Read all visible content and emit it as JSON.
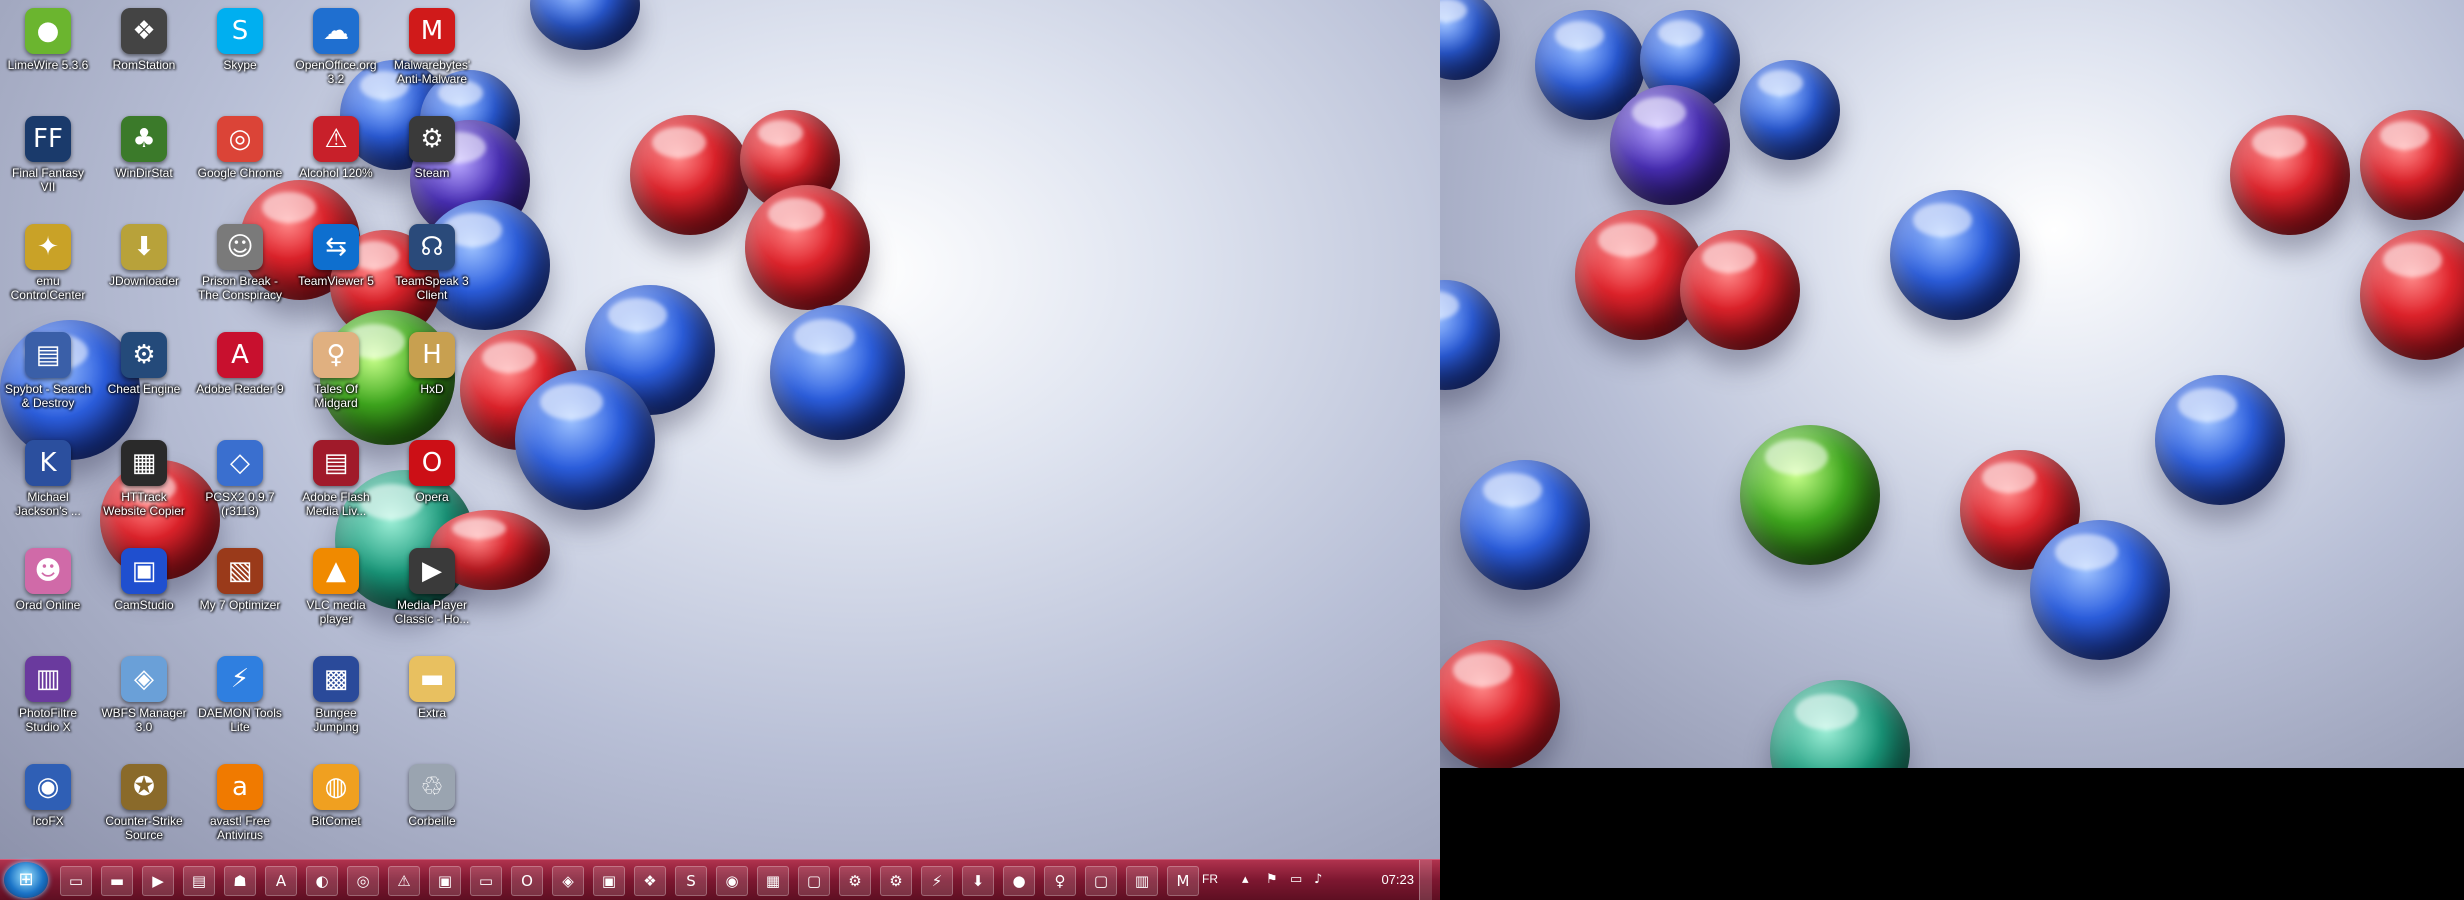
{
  "desktop": {
    "icons": [
      {
        "label": "LimeWire 5.3.6",
        "icon": "limewire-icon",
        "color": "#6bb52f",
        "glyph": "●"
      },
      {
        "label": "Final Fantasy VII",
        "icon": "final-fantasy-icon",
        "color": "#1a3a6b",
        "glyph": "FF"
      },
      {
        "label": "emu ControlCenter",
        "icon": "emucontrolcenter-icon",
        "color": "#c9a227",
        "glyph": "✦"
      },
      {
        "label": "Spybot - Search & Destroy",
        "icon": "spybot-icon",
        "color": "#3a5fa8",
        "glyph": "▤"
      },
      {
        "label": "Michael Jackson's ...",
        "icon": "michael-jackson-icon",
        "color": "#2b4f9e",
        "glyph": "K"
      },
      {
        "label": "Orad Online",
        "icon": "orad-online-icon",
        "color": "#d06aa8",
        "glyph": "☻"
      },
      {
        "label": "PhotoFiltre Studio X",
        "icon": "photofiltre-icon",
        "color": "#6a3a9e",
        "glyph": "▥"
      },
      {
        "label": "IcoFX",
        "icon": "icofx-icon",
        "color": "#2f5fb5",
        "glyph": "◉"
      },
      {
        "label": "RomStation",
        "icon": "romstation-icon",
        "color": "#444444",
        "glyph": "❖"
      },
      {
        "label": "WinDirStat",
        "icon": "windirstat-icon",
        "color": "#3b7a2a",
        "glyph": "♣"
      },
      {
        "label": "JDownloader",
        "icon": "jdownloader-icon",
        "color": "#b8a23a",
        "glyph": "⬇"
      },
      {
        "label": "Cheat Engine",
        "icon": "cheat-engine-icon",
        "color": "#244a7a",
        "glyph": "⚙"
      },
      {
        "label": "HTTrack Website Copier",
        "icon": "httrack-icon",
        "color": "#2a2a2a",
        "glyph": "▦"
      },
      {
        "label": "CamStudio",
        "icon": "camstudio-icon",
        "color": "#1f4fcf",
        "glyph": "▣"
      },
      {
        "label": "WBFS Manager 3.0",
        "icon": "wbfs-manager-icon",
        "color": "#6aa0d8",
        "glyph": "◈"
      },
      {
        "label": "Counter-Strike Source",
        "icon": "counter-strike-icon",
        "color": "#8a6a2a",
        "glyph": "✪"
      },
      {
        "label": "Skype",
        "icon": "skype-icon",
        "color": "#00aff0",
        "glyph": "S"
      },
      {
        "label": "Google Chrome",
        "icon": "chrome-icon",
        "color": "#db4437",
        "glyph": "◎"
      },
      {
        "label": "Prison Break - The Conspiracy",
        "icon": "prison-break-icon",
        "color": "#7a7a7a",
        "glyph": "☺"
      },
      {
        "label": "Adobe Reader 9",
        "icon": "adobe-reader-icon",
        "color": "#c8102e",
        "glyph": "A"
      },
      {
        "label": "PCSX2 0.9.7 (r3113)",
        "icon": "pcsx2-icon",
        "color": "#3a6fcf",
        "glyph": "◇"
      },
      {
        "label": "My 7 Optimizer",
        "icon": "optimizer-icon",
        "color": "#9a3a1a",
        "glyph": "▧"
      },
      {
        "label": "DAEMON Tools Lite",
        "icon": "daemon-tools-icon",
        "color": "#2f7fe0",
        "glyph": "⚡"
      },
      {
        "label": "avast! Free Antivirus",
        "icon": "avast-icon",
        "color": "#f07a00",
        "glyph": "a"
      },
      {
        "label": "OpenOffice.org 3.2",
        "icon": "openoffice-icon",
        "color": "#1f6fd0",
        "glyph": "☁"
      },
      {
        "label": "Alcohol 120%",
        "icon": "alcohol-icon",
        "color": "#c8202a",
        "glyph": "⚠"
      },
      {
        "label": "TeamViewer 5",
        "icon": "teamviewer-icon",
        "color": "#0e6fcf",
        "glyph": "⇆"
      },
      {
        "label": "Tales Of Midgard",
        "icon": "tales-of-midgard-icon",
        "color": "#e0b080",
        "glyph": "♀"
      },
      {
        "label": "Adobe Flash Media Liv...",
        "icon": "adobe-flash-icon",
        "color": "#a01a2a",
        "glyph": "▤"
      },
      {
        "label": "VLC media player",
        "icon": "vlc-icon",
        "color": "#f08a00",
        "glyph": "▲"
      },
      {
        "label": "Bungee Jumping",
        "icon": "bungee-jumping-icon",
        "color": "#2a4a9a",
        "glyph": "▩"
      },
      {
        "label": "BitComet",
        "icon": "bitcomet-icon",
        "color": "#f0a020",
        "glyph": "◍"
      },
      {
        "label": "Malwarebytes' Anti-Malware",
        "icon": "malwarebytes-icon",
        "color": "#d01a1a",
        "glyph": "M"
      },
      {
        "label": "Steam",
        "icon": "steam-icon",
        "color": "#3a3a3a",
        "glyph": "⚙"
      },
      {
        "label": "TeamSpeak 3 Client",
        "icon": "teamspeak-icon",
        "color": "#2a4a7a",
        "glyph": "☊"
      },
      {
        "label": "HxD",
        "icon": "hxd-icon",
        "color": "#c8a050",
        "glyph": "H"
      },
      {
        "label": "Opera",
        "icon": "opera-icon",
        "color": "#cc0f16",
        "glyph": "O"
      },
      {
        "label": "Media Player Classic - Ho...",
        "icon": "media-player-classic-icon",
        "color": "#3a3a3a",
        "glyph": "▶"
      },
      {
        "label": "Extra",
        "icon": "folder-icon",
        "color": "#e8c060",
        "glyph": "▬"
      },
      {
        "label": "Corbeille",
        "icon": "recycle-bin-icon",
        "color": "#9aa4b0",
        "glyph": "♲"
      }
    ]
  },
  "taskbar": {
    "start_glyph": "⊞",
    "buttons": [
      {
        "icon": "explorer-icon",
        "glyph": "▭"
      },
      {
        "icon": "folder-icon",
        "glyph": "▬"
      },
      {
        "icon": "media-player-icon",
        "glyph": "▶"
      },
      {
        "icon": "document-icon",
        "glyph": "▤"
      },
      {
        "icon": "network-icon",
        "glyph": "☗"
      },
      {
        "icon": "adobe-reader-icon",
        "glyph": "A"
      },
      {
        "icon": "explorer-window-icon",
        "glyph": "◐"
      },
      {
        "icon": "chrome-icon",
        "glyph": "◎"
      },
      {
        "icon": "alcohol-icon",
        "glyph": "⚠"
      },
      {
        "icon": "computer-icon",
        "glyph": "▣"
      },
      {
        "icon": "display-icon",
        "glyph": "▭"
      },
      {
        "icon": "opera-icon",
        "glyph": "O"
      },
      {
        "icon": "daemon-icon",
        "glyph": "◈"
      },
      {
        "icon": "camstudio-icon",
        "glyph": "▣"
      },
      {
        "icon": "romstation-icon",
        "glyph": "❖"
      },
      {
        "icon": "skype-icon",
        "glyph": "S"
      },
      {
        "icon": "app-icon",
        "glyph": "◉"
      },
      {
        "icon": "calendar-icon",
        "glyph": "▦"
      },
      {
        "icon": "window-icon",
        "glyph": "▢"
      },
      {
        "icon": "cheat-engine-icon",
        "glyph": "⚙"
      },
      {
        "icon": "settings-icon",
        "glyph": "⚙"
      },
      {
        "icon": "daemon-tools-icon",
        "glyph": "⚡"
      },
      {
        "icon": "jdownloader-icon",
        "glyph": "⬇"
      },
      {
        "icon": "game-icon",
        "glyph": "●"
      },
      {
        "icon": "tales-icon",
        "glyph": "♀"
      },
      {
        "icon": "window2-icon",
        "glyph": "▢"
      },
      {
        "icon": "paint-icon",
        "glyph": "▥"
      },
      {
        "icon": "malwarebytes-icon",
        "glyph": "M"
      }
    ],
    "tray": {
      "language": "FR",
      "clock": "07:23",
      "icons": [
        {
          "icon": "chevron-up-icon",
          "glyph": "▴"
        },
        {
          "icon": "flag-icon",
          "glyph": "⚑"
        },
        {
          "icon": "network-icon",
          "glyph": "▭"
        },
        {
          "icon": "volume-icon",
          "glyph": "♪"
        }
      ]
    }
  },
  "colors": {
    "taskbar": "#7d1730",
    "start_orb": "#1b74c7"
  }
}
